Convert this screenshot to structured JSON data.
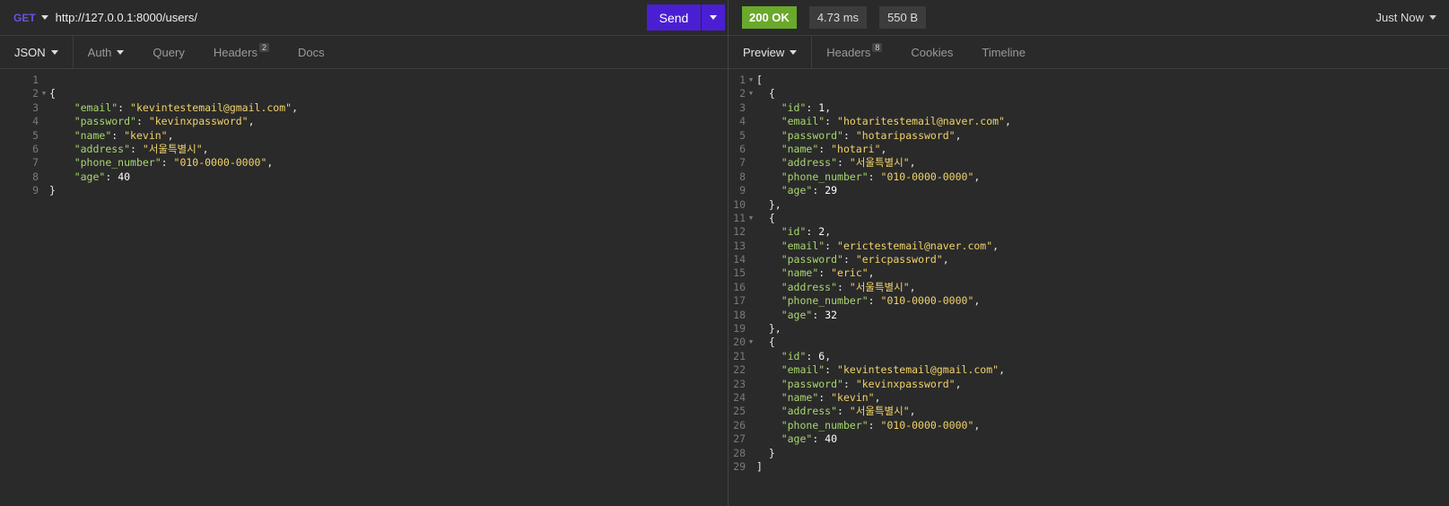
{
  "request": {
    "method": "GET",
    "url": "http://127.0.0.1:8000/users/",
    "send_label": "Send",
    "tabs": [
      {
        "label": "JSON",
        "dropdown": true,
        "active": true
      },
      {
        "label": "Auth",
        "dropdown": true,
        "active": false
      },
      {
        "label": "Query",
        "active": false
      },
      {
        "label": "Headers",
        "badge": "2",
        "active": false
      },
      {
        "label": "Docs",
        "active": false
      }
    ],
    "body_lines": [
      "",
      "{",
      "    \"email\": \"kevintestemail@gmail.com\",",
      "    \"password\": \"kevinxpassword\",",
      "    \"name\": \"kevin\",",
      "    \"address\": \"서울특별시\",",
      "    \"phone_number\": \"010-0000-0000\",",
      "    \"age\": 40",
      "}"
    ],
    "fold_lines": [
      2
    ]
  },
  "response": {
    "status": "200 OK",
    "time": "4.73 ms",
    "size": "550 B",
    "when": "Just Now",
    "tabs": [
      {
        "label": "Preview",
        "dropdown": true,
        "active": true
      },
      {
        "label": "Headers",
        "badge": "8",
        "active": false
      },
      {
        "label": "Cookies",
        "active": false
      },
      {
        "label": "Timeline",
        "active": false
      }
    ],
    "body_lines": [
      "[",
      "  {",
      "    \"id\": 1,",
      "    \"email\": \"hotaritestemail@naver.com\",",
      "    \"password\": \"hotaripassword\",",
      "    \"name\": \"hotari\",",
      "    \"address\": \"서울특별시\",",
      "    \"phone_number\": \"010-0000-0000\",",
      "    \"age\": 29",
      "  },",
      "  {",
      "    \"id\": 2,",
      "    \"email\": \"erictestemail@naver.com\",",
      "    \"password\": \"ericpassword\",",
      "    \"name\": \"eric\",",
      "    \"address\": \"서울특별시\",",
      "    \"phone_number\": \"010-0000-0000\",",
      "    \"age\": 32",
      "  },",
      "  {",
      "    \"id\": 6,",
      "    \"email\": \"kevintestemail@gmail.com\",",
      "    \"password\": \"kevinxpassword\",",
      "    \"name\": \"kevin\",",
      "    \"address\": \"서울특별시\",",
      "    \"phone_number\": \"010-0000-0000\",",
      "    \"age\": 40",
      "  }",
      "]"
    ],
    "fold_lines": [
      1,
      2,
      11,
      20
    ]
  },
  "colors": {
    "accent": "#4a1fd3",
    "method": "#6f4fe3",
    "status_ok": "#6aa92c",
    "json_key": "#a8d66f",
    "json_string": "#f0d36b"
  }
}
